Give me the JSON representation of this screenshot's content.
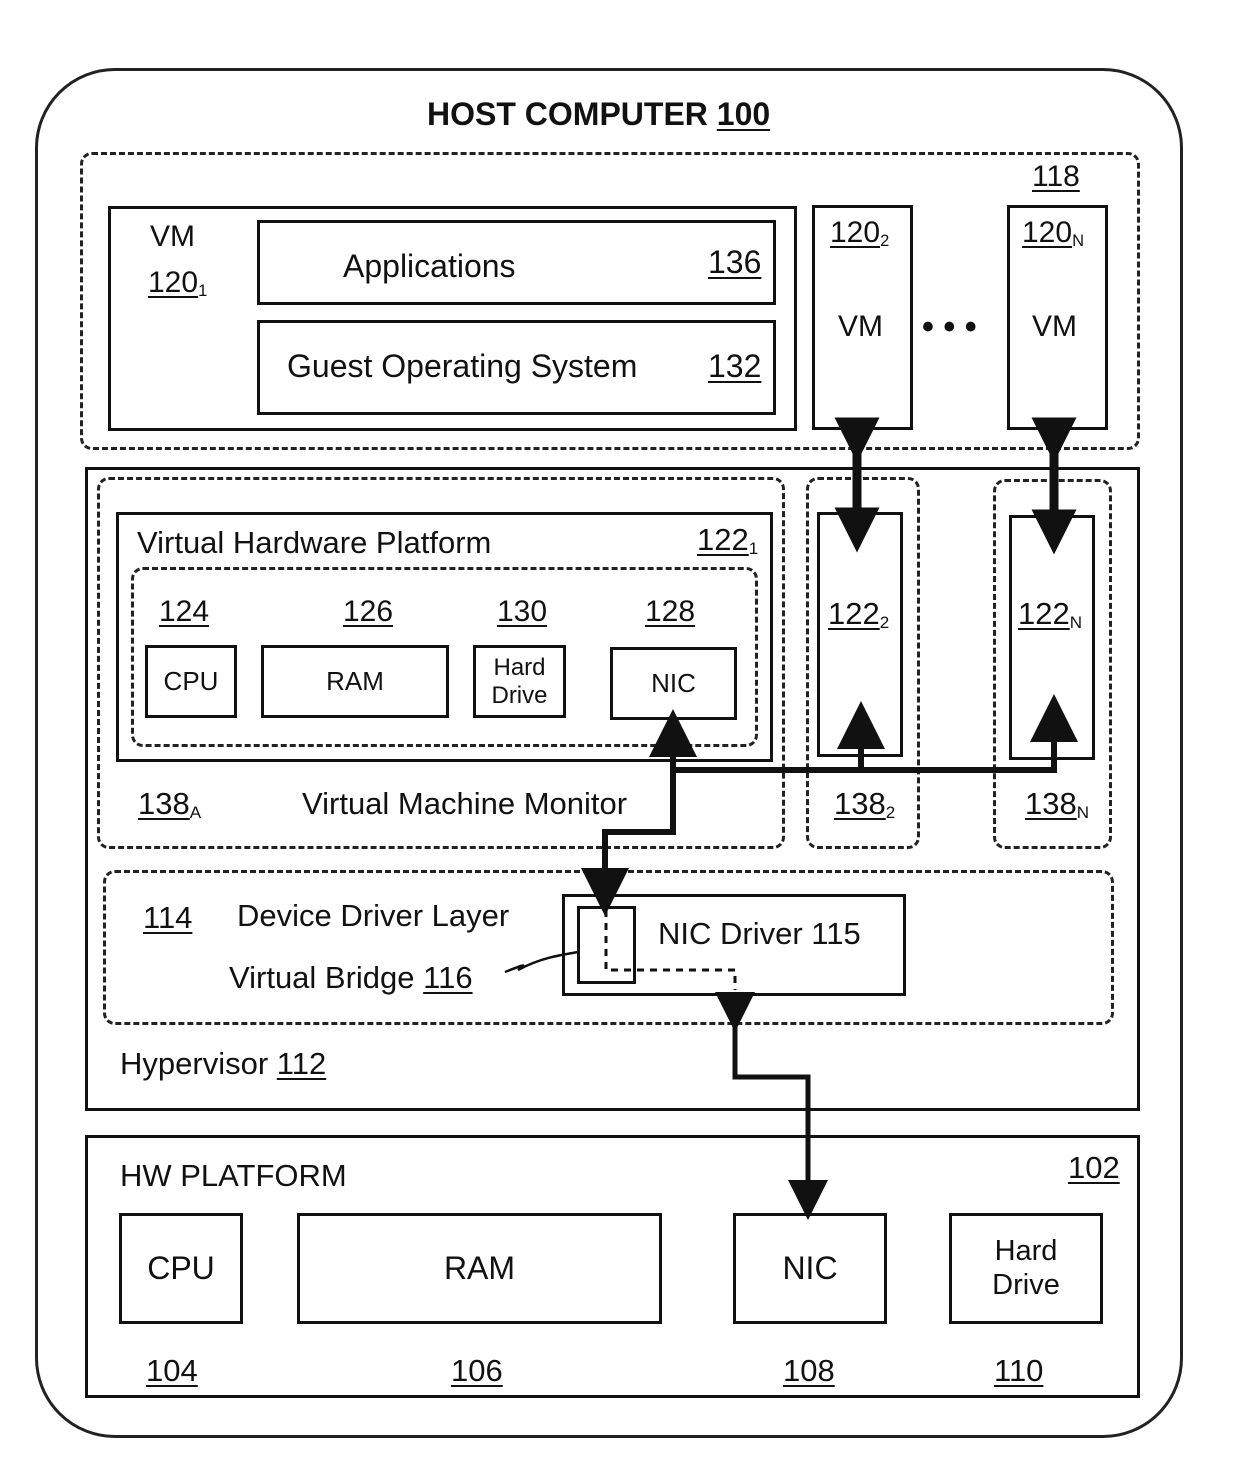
{
  "host": {
    "title": "HOST COMPUTER",
    "ref": "100"
  },
  "vm_group": {
    "ref": "118"
  },
  "vm1": {
    "label": "VM",
    "ref": "120",
    "sub": "1",
    "applications": {
      "label": "Applications",
      "ref": "136"
    },
    "guest_os": {
      "label": "Guest Operating System",
      "ref": "132"
    }
  },
  "vm2": {
    "label": "VM",
    "ref": "120",
    "sub": "2"
  },
  "vmN": {
    "label": "VM",
    "ref": "120",
    "sub": "N"
  },
  "ellipsis": "• • •",
  "vmm1": {
    "label": "Virtual Machine Monitor",
    "ref": "138",
    "sub": "A",
    "vhp": {
      "label": "Virtual Hardware Platform",
      "ref": "122",
      "sub": "1",
      "devices": [
        {
          "ref": "124",
          "label": "CPU"
        },
        {
          "ref": "126",
          "label": "RAM"
        },
        {
          "ref": "130",
          "label": "Hard Drive",
          "line1": "Hard",
          "line2": "Drive"
        },
        {
          "ref": "128",
          "label": "NIC"
        }
      ]
    }
  },
  "vmm2": {
    "ref": "138",
    "sub": "2",
    "vhp": {
      "ref": "122",
      "sub": "2"
    }
  },
  "vmmN": {
    "ref": "138",
    "sub": "N",
    "vhp": {
      "ref": "122",
      "sub": "N"
    }
  },
  "driver_layer": {
    "ref": "114",
    "label": "Device Driver Layer",
    "nic_driver": "NIC Driver 115",
    "bridge": {
      "label": "Virtual Bridge",
      "ref": "116"
    }
  },
  "hypervisor": {
    "label": "Hypervisor",
    "ref": "112"
  },
  "hw": {
    "title": "HW PLATFORM",
    "ref": "102",
    "devices": [
      {
        "label": "CPU",
        "ref": "104"
      },
      {
        "label": "RAM",
        "ref": "106"
      },
      {
        "label": "NIC",
        "ref": "108"
      },
      {
        "label": "Hard Drive",
        "line1": "Hard",
        "line2": "Drive",
        "ref": "110"
      }
    ]
  }
}
